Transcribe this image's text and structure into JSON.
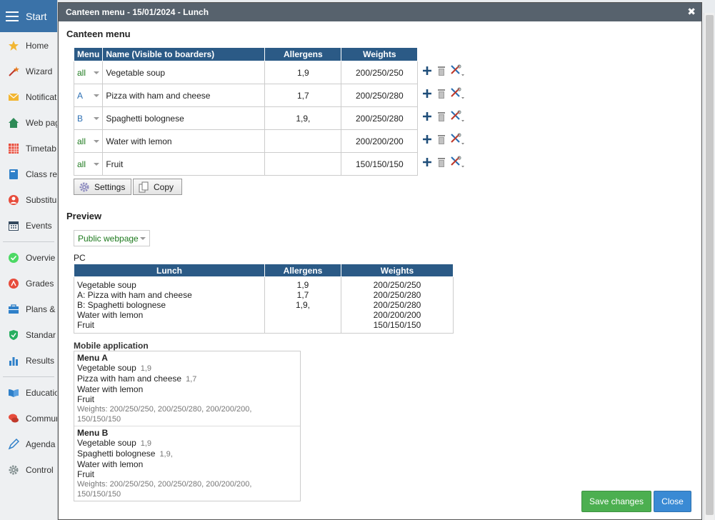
{
  "sidebar": {
    "start_label": "Start",
    "items": [
      {
        "label": "Home",
        "icon": "star-icon"
      },
      {
        "label": "Wizard",
        "icon": "wand-icon"
      },
      {
        "label": "Notificat",
        "icon": "envelope-icon"
      },
      {
        "label": "Web pag",
        "icon": "house-icon"
      },
      {
        "label": "Timetab",
        "icon": "calendar-grid-icon"
      },
      {
        "label": "Class re",
        "icon": "book-icon"
      },
      {
        "label": "Substitu",
        "icon": "person-icon"
      },
      {
        "label": "Events",
        "icon": "calendar-icon"
      },
      {
        "label": "Overvie",
        "icon": "check-circle-icon"
      },
      {
        "label": "Grades",
        "icon": "grade-circle-icon"
      },
      {
        "label": "Plans &",
        "icon": "briefcase-icon"
      },
      {
        "label": "Standar",
        "icon": "shield-check-icon"
      },
      {
        "label": "Results",
        "icon": "bar-chart-icon"
      },
      {
        "label": "Educatio",
        "icon": "open-book-icon"
      },
      {
        "label": "Commun",
        "icon": "chat-icon"
      },
      {
        "label": "Agenda",
        "icon": "pen-icon"
      },
      {
        "label": "Control",
        "icon": "gear-icon"
      }
    ]
  },
  "dialog": {
    "title": "Canteen menu - 15/01/2024 - Lunch",
    "close_symbol": "✖"
  },
  "canteen": {
    "section_title": "Canteen menu",
    "headers": {
      "menu": "Menu",
      "name": "Name (Visible to boarders)",
      "allergens": "Allergens",
      "weights": "Weights"
    },
    "rows": [
      {
        "menu": "all",
        "name": "Vegetable soup",
        "allergens": "1,9",
        "weights": "200/250/250"
      },
      {
        "menu": "A",
        "name": "Pizza with ham and cheese",
        "allergens": "1,7",
        "weights": "200/250/280"
      },
      {
        "menu": "B",
        "name": "Spaghetti bolognese",
        "allergens": "1,9,",
        "weights": "200/250/280"
      },
      {
        "menu": "all",
        "name": "Water with lemon",
        "allergens": "",
        "weights": "200/200/200"
      },
      {
        "menu": "all",
        "name": "Fruit",
        "allergens": "",
        "weights": "150/150/150"
      }
    ],
    "settings_label": "Settings",
    "copy_label": "Copy"
  },
  "preview": {
    "section_title": "Preview",
    "select_value": "Public webpage",
    "pc_label": "PC",
    "pc_headers": {
      "lunch": "Lunch",
      "allergens": "Allergens",
      "weights": "Weights"
    },
    "pc_lines": [
      {
        "name": "Vegetable soup",
        "allergens": "1,9",
        "weights": "200/250/250"
      },
      {
        "name": "A: Pizza with ham and cheese",
        "allergens": "1,7",
        "weights": "200/250/280"
      },
      {
        "name": "B: Spaghetti bolognese",
        "allergens": "1,9,",
        "weights": "200/250/280"
      },
      {
        "name": "Water with lemon",
        "allergens": "",
        "weights": "200/200/200"
      },
      {
        "name": "Fruit",
        "allergens": "",
        "weights": "150/150/150"
      }
    ],
    "mobile_label": "Mobile application",
    "mobile_menus": [
      {
        "title": "Menu A",
        "items": [
          {
            "name": "Vegetable soup",
            "allergens": "1,9"
          },
          {
            "name": "Pizza with ham and cheese",
            "allergens": "1,7"
          },
          {
            "name": "Water with lemon",
            "allergens": ""
          },
          {
            "name": "Fruit",
            "allergens": ""
          }
        ],
        "weights": "Weights: 200/250/250, 200/250/280, 200/200/200, 150/150/150"
      },
      {
        "title": "Menu B",
        "items": [
          {
            "name": "Vegetable soup",
            "allergens": "1,9"
          },
          {
            "name": "Spaghetti bolognese",
            "allergens": "1,9,"
          },
          {
            "name": "Water with lemon",
            "allergens": ""
          },
          {
            "name": "Fruit",
            "allergens": ""
          }
        ],
        "weights": "Weights: 200/250/250, 200/250/280, 200/200/200, 150/150/150"
      }
    ]
  },
  "footer": {
    "save_label": "Save changes",
    "close_label": "Close"
  },
  "colors": {
    "header_blue": "#2b5a86",
    "start_blue": "#3a72a8",
    "save_green": "#4caf50",
    "close_blue": "#3a8ad4",
    "menu_all_green": "#1e7a1e",
    "menu_ab_blue": "#2c6fb3"
  }
}
